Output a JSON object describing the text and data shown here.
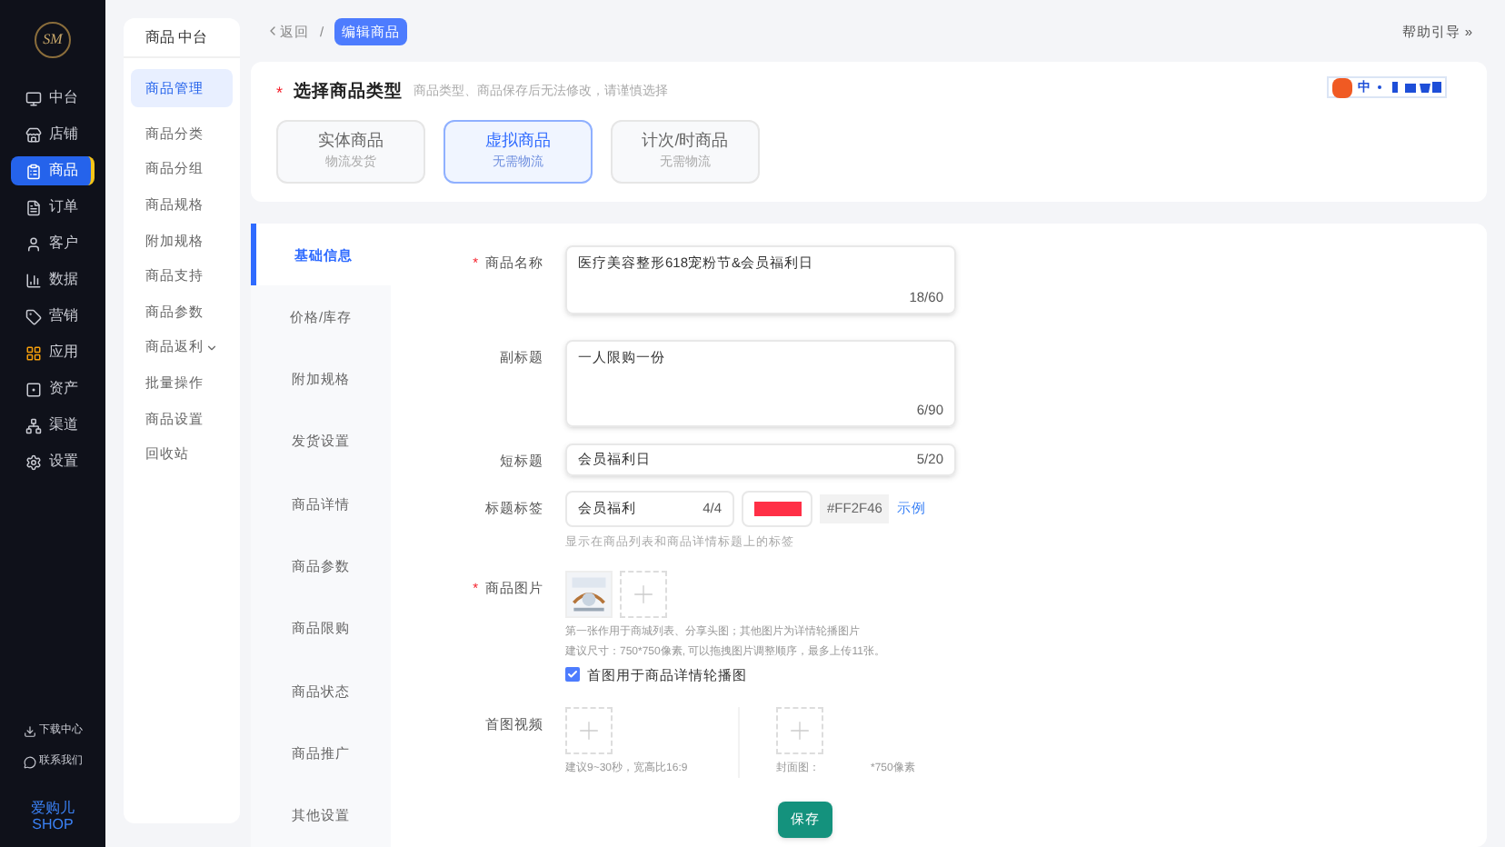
{
  "logo": {
    "text": "SM"
  },
  "main_nav": [
    {
      "label": "中台",
      "selected": false
    },
    {
      "label": "店铺",
      "selected": false
    },
    {
      "label": "商品",
      "selected": true
    },
    {
      "label": "订单",
      "selected": false
    },
    {
      "label": "客户",
      "selected": false
    },
    {
      "label": "数据",
      "selected": false
    },
    {
      "label": "营销",
      "selected": false
    },
    {
      "label": "应用",
      "selected": false
    },
    {
      "label": "资产",
      "selected": false
    },
    {
      "label": "渠道",
      "selected": false
    },
    {
      "label": "设置",
      "selected": false
    }
  ],
  "nav_footer": [
    {
      "label": "下载中心"
    },
    {
      "label": "联系我们"
    }
  ],
  "brand": {
    "line1": "爱购儿",
    "line2": "SHOP"
  },
  "sub_nav": {
    "title": "商品 中台",
    "items": [
      {
        "label": "商品管理",
        "selected": true,
        "has_arrow": false
      },
      {
        "label": "商品分类",
        "selected": false,
        "has_arrow": false
      },
      {
        "label": "商品分组",
        "selected": false,
        "has_arrow": false
      },
      {
        "label": "商品规格",
        "selected": false,
        "has_arrow": false
      },
      {
        "label": "附加规格",
        "selected": false,
        "has_arrow": false
      },
      {
        "label": "商品支持",
        "selected": false,
        "has_arrow": false
      },
      {
        "label": "商品参数",
        "selected": false,
        "has_arrow": false
      },
      {
        "label": "商品返利",
        "selected": false,
        "has_arrow": true
      },
      {
        "label": "批量操作",
        "selected": false,
        "has_arrow": false
      },
      {
        "label": "商品设置",
        "selected": false,
        "has_arrow": false
      },
      {
        "label": "回收站",
        "selected": false,
        "has_arrow": false
      }
    ]
  },
  "breadcrumb": {
    "back": "返回",
    "separator": "/",
    "current": "编辑商品"
  },
  "help_link": "帮助引导 »",
  "ime_toolbar": {
    "label": "中"
  },
  "type_section": {
    "required_mark": "*",
    "title": "选择商品类型",
    "hint": "商品类型、商品保存后无法修改，请谨慎选择",
    "options": [
      {
        "name": "实体商品",
        "sub": "物流发货",
        "selected": false
      },
      {
        "name": "虚拟商品",
        "sub": "无需物流",
        "selected": true
      },
      {
        "name": "计次/时商品",
        "sub": "无需物流",
        "selected": false
      }
    ]
  },
  "form_tabs": [
    {
      "label": "基础信息",
      "selected": true
    },
    {
      "label": "价格/库存",
      "selected": false
    },
    {
      "label": "附加规格",
      "selected": false
    },
    {
      "label": "发货设置",
      "selected": false
    },
    {
      "label": "商品详情",
      "selected": false
    },
    {
      "label": "商品参数",
      "selected": false
    },
    {
      "label": "商品限购",
      "selected": false
    },
    {
      "label": "商品状态",
      "selected": false
    },
    {
      "label": "商品推广",
      "selected": false
    },
    {
      "label": "其他设置",
      "selected": false
    }
  ],
  "fields": {
    "name": {
      "label": "商品名称",
      "required": true,
      "value": "医疗美容整形618宠粉节&会员福利日",
      "count": "18/60"
    },
    "subtitle": {
      "label": "副标题",
      "required": false,
      "value": "一人限购一份",
      "count": "6/90"
    },
    "short_title": {
      "label": "短标题",
      "required": false,
      "value": "会员福利日",
      "count": "5/20"
    },
    "title_tag": {
      "label": "标题标签",
      "required": false,
      "value": "会员福利",
      "count": "4/4",
      "color": "#ff2f46",
      "hex": "#FF2F46",
      "example": "示例",
      "hint": "显示在商品列表和商品详情标题上的标签"
    },
    "images": {
      "label": "商品图片",
      "required": true,
      "hint1": "第一张作用于商城列表、分享头图；其他图片为详情轮播图片",
      "hint2": "建议尺寸：750*750像素, 可以拖拽图片调整顺序，最多上传11张。",
      "checkbox_label": "首图用于商品详情轮播图",
      "checked": true
    },
    "video": {
      "label": "首图视频",
      "required": false,
      "video_hint": "建议9~30秒，宽高比16:9",
      "cover_hint_start": "封面图：",
      "cover_hint_end": "*750像素"
    }
  },
  "save_button": "保存"
}
